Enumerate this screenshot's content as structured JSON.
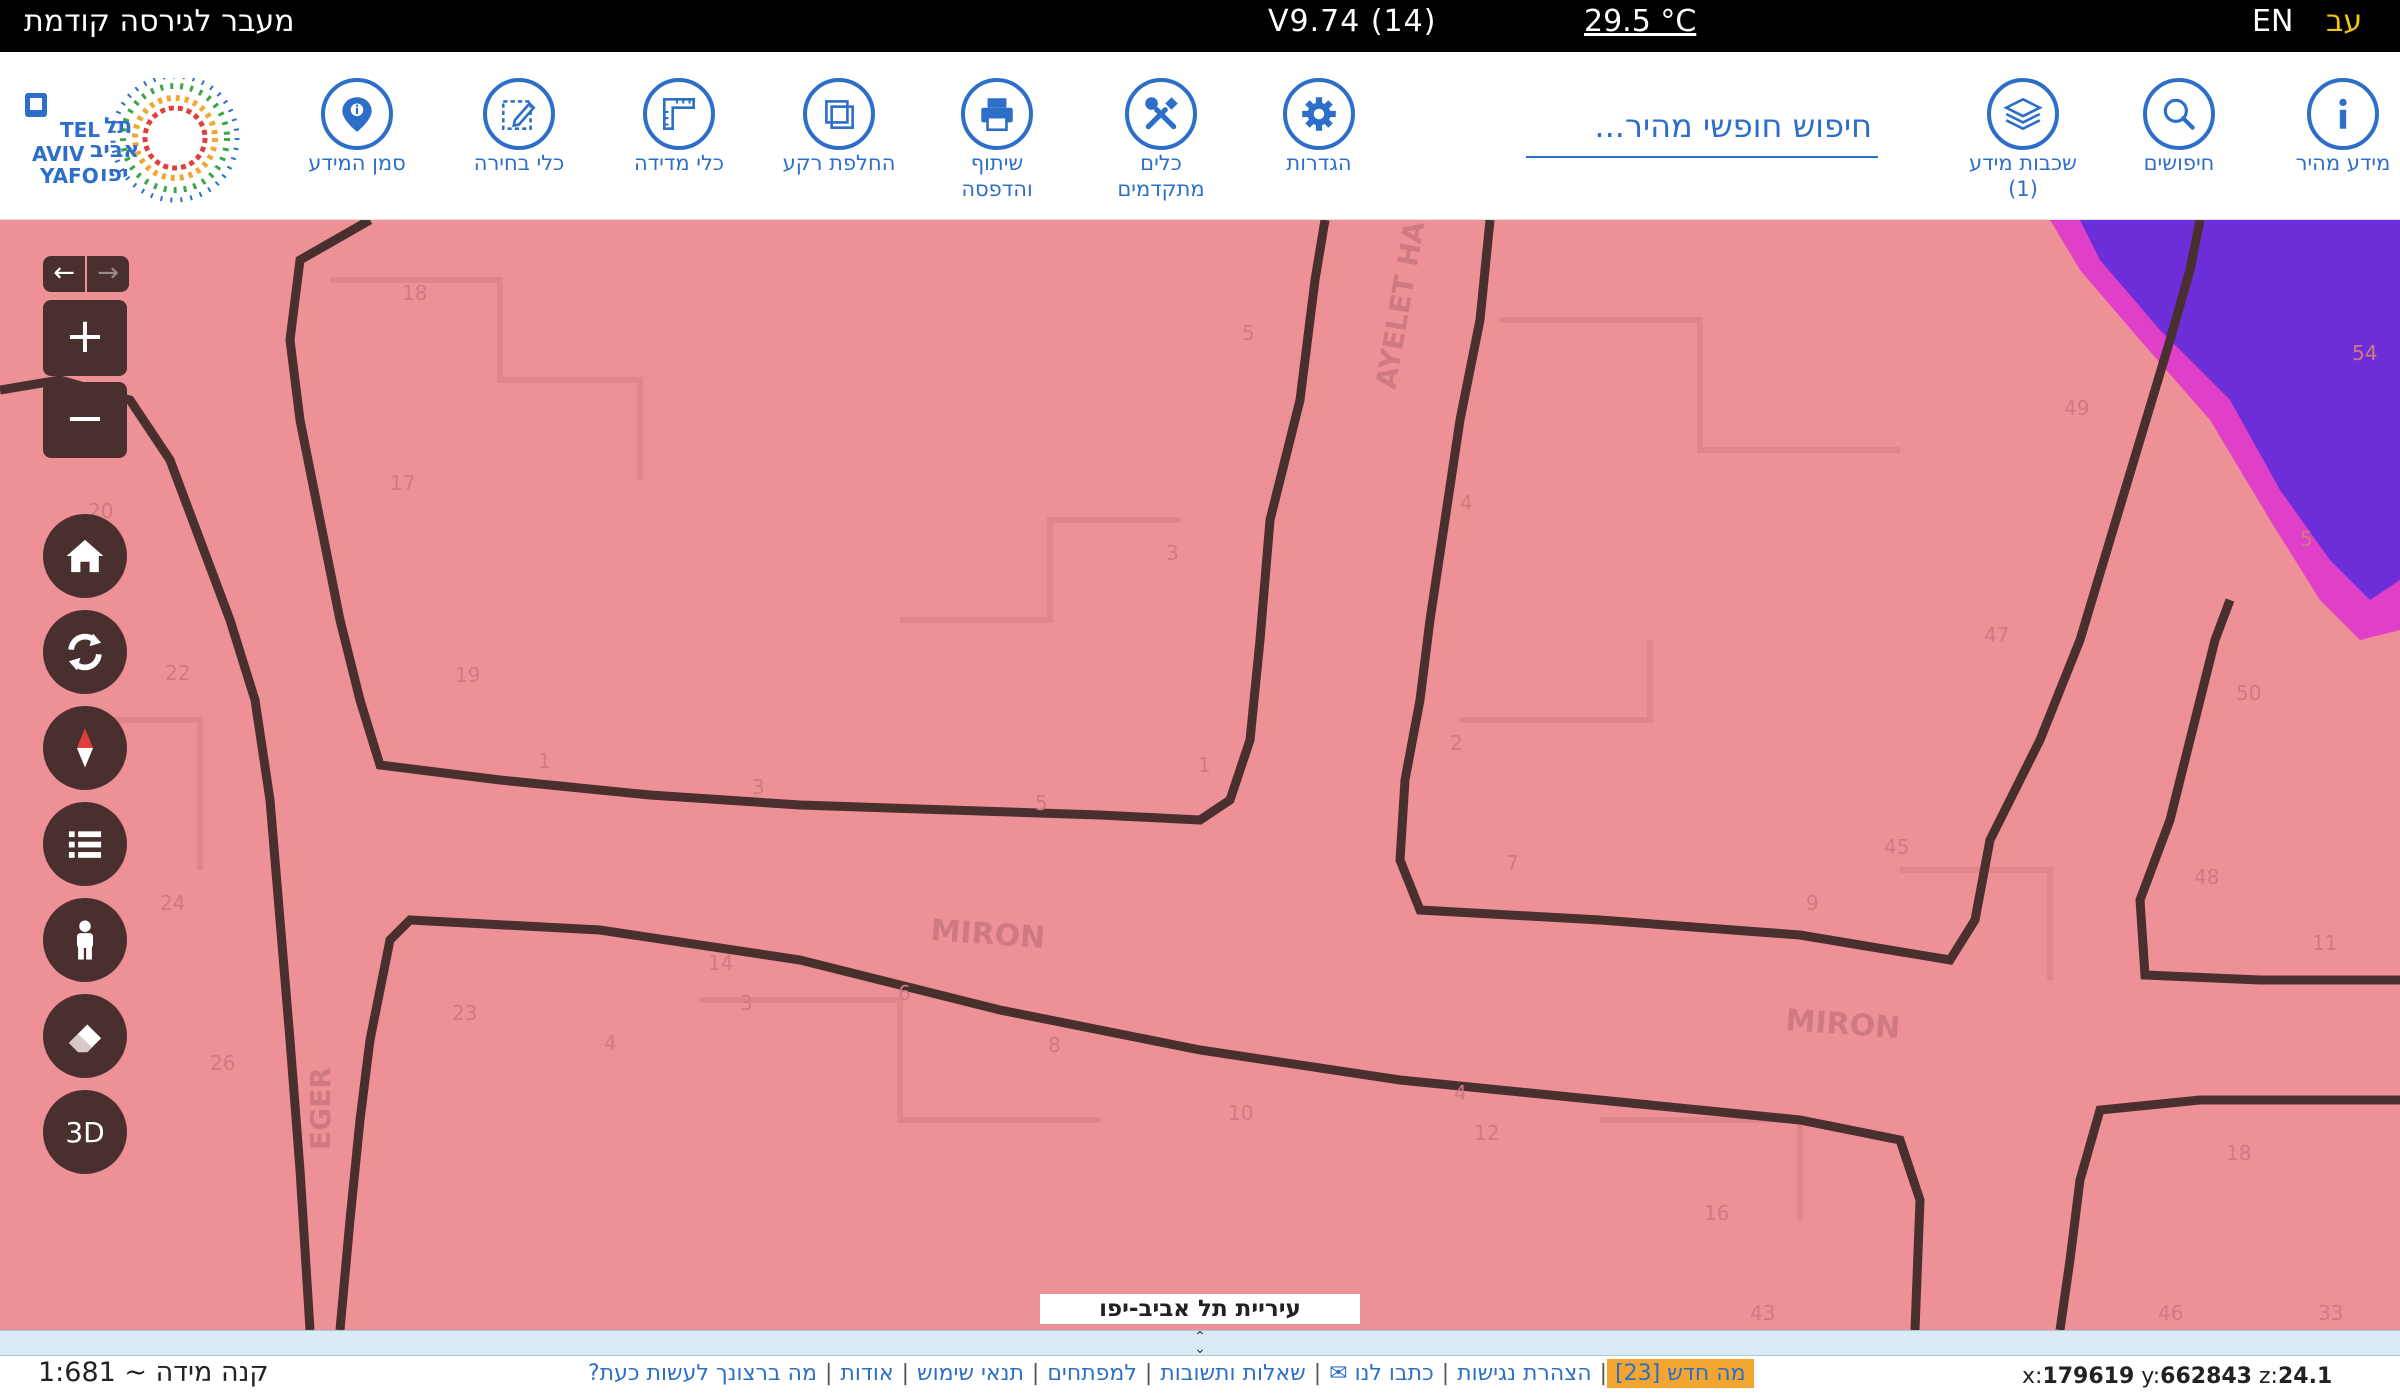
{
  "topbar": {
    "prev_version": "מעבר לגירסה קודמת",
    "version": "V9.74 (14)",
    "temperature": "29.5 °C",
    "lang_en": "EN",
    "lang_he": "עב"
  },
  "toolbar": {
    "quick_info": "מידע מהיר",
    "searches": "חיפושים",
    "layers_line1": "שכבות מידע",
    "layers_line2": "(1)",
    "search_placeholder": "חיפוש חופשי מהיר...",
    "settings": "הגדרות",
    "advanced_line1": "כלים",
    "advanced_line2": "מתקדמים",
    "share_line1": "שיתוף",
    "share_line2": "והדפסה",
    "basemap": "החלפת רקע",
    "measure": "כלי מדידה",
    "select": "כלי בחירה",
    "marker": "סמן המידע"
  },
  "logo": {
    "line1_en": "TEL",
    "line1_he": "תל",
    "line2_en": "AVIV",
    "line2_he": "אביב",
    "line3_en": "YAFO",
    "line3_he": "יפו"
  },
  "map": {
    "street_labels": [
      "MIRON",
      "MIRON",
      "EGER",
      "AYELET HA"
    ],
    "house_numbers": [
      "18",
      "17",
      "20",
      "22",
      "19",
      "1",
      "3",
      "5",
      "1",
      "3",
      "5",
      "24",
      "26",
      "23",
      "4",
      "6",
      "8",
      "10",
      "12",
      "16",
      "43",
      "2",
      "4",
      "7",
      "9",
      "45",
      "48",
      "47",
      "49",
      "50",
      "11",
      "54",
      "5",
      "18",
      "46",
      "33",
      "3",
      "14",
      "4"
    ],
    "city_label": "עיריית תל אביב-יפו",
    "colors": {
      "map_fill": "#ee9196",
      "street_line": "#4a2f2f",
      "layer_purple": "#6b2ed8",
      "layer_magenta": "#e040c8"
    },
    "controls": {
      "back": "←",
      "forward": "→",
      "zoom_in": "+",
      "zoom_out": "−",
      "three_d": "3D"
    }
  },
  "footer": {
    "scale": "קנה מידה ~ 1:681",
    "links": [
      "מה ברצונך לעשות כעת?",
      "אודות",
      "תנאי שימוש",
      "למפתחים",
      "שאלות ותשובות",
      "כתבו לנו ✉",
      "הצהרת נגישות"
    ],
    "whats_new": "מה חדש [23]",
    "x_label": "x:",
    "x_value": "179619",
    "y_label": "y:",
    "y_value": "662843",
    "z_label": "z:",
    "z_value": "24.1"
  }
}
